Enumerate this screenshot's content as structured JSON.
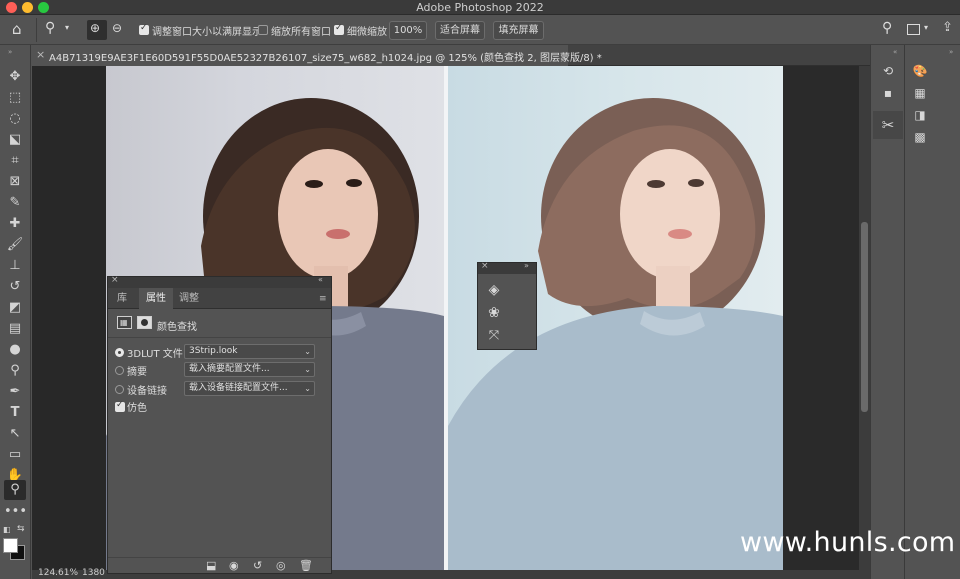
{
  "window": {
    "title": "Adobe Photoshop 2022",
    "traffic_colors": [
      "#fe5f57",
      "#febc2e",
      "#28c840"
    ]
  },
  "options_bar": {
    "zoom_in_icon": "zoom-in-icon",
    "zoom_out_icon": "zoom-out-icon",
    "resize_windows_label": "调整窗口大小以满屏显示",
    "resize_windows_checked": true,
    "zoom_all_label": "缩放所有窗口",
    "zoom_all_checked": false,
    "scrubby_zoom_label": "细微缩放",
    "scrubby_zoom_checked": true,
    "percent_button": "100%",
    "fit_screen_button": "适合屏幕",
    "fill_screen_button": "填充屏幕"
  },
  "document": {
    "tab_label": "A4B71319E9AE3F1E60D591F55D0AE52327B26107_size75_w682_h1024.jpg @ 125% (颜色查找 2, 图层蒙版/8) *"
  },
  "status": {
    "zoom": "124.61%",
    "size": "1380"
  },
  "properties_panel": {
    "tabs": [
      "库",
      "属性",
      "调整"
    ],
    "active_tab": 1,
    "adjustment_name": "颜色查找",
    "rows": [
      {
        "label": "3DLUT 文件",
        "value": "3Strip.look",
        "selected": true
      },
      {
        "label": "摘要",
        "value": "载入摘要配置文件...",
        "selected": false
      },
      {
        "label": "设备链接",
        "value": "载入设备链接配置文件...",
        "selected": false
      }
    ],
    "dither_label": "仿色",
    "dither_checked": true
  },
  "watermark": "www.hunls.com"
}
